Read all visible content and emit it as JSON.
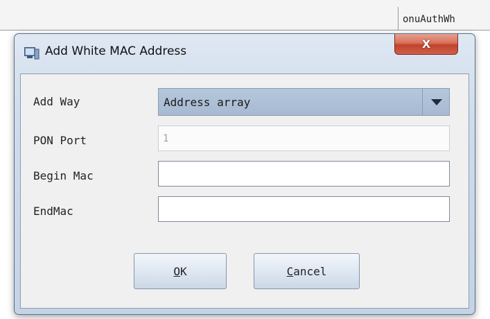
{
  "background": {
    "column_header": "onuAuthWh"
  },
  "dialog": {
    "title": "Add White MAC Address",
    "close_label": "X",
    "icon": "window-app-icon",
    "form": {
      "add_way_label": "Add Way",
      "add_way_value": "Address array",
      "pon_port_label": "PON Port",
      "pon_port_value": "1",
      "begin_mac_label": "Begin Mac",
      "begin_mac_value": "",
      "end_mac_label": "EndMac",
      "end_mac_value": ""
    },
    "buttons": {
      "ok_mnemonic": "O",
      "ok_rest": "K",
      "cancel_mnemonic": "C",
      "cancel_rest": "ancel"
    }
  }
}
